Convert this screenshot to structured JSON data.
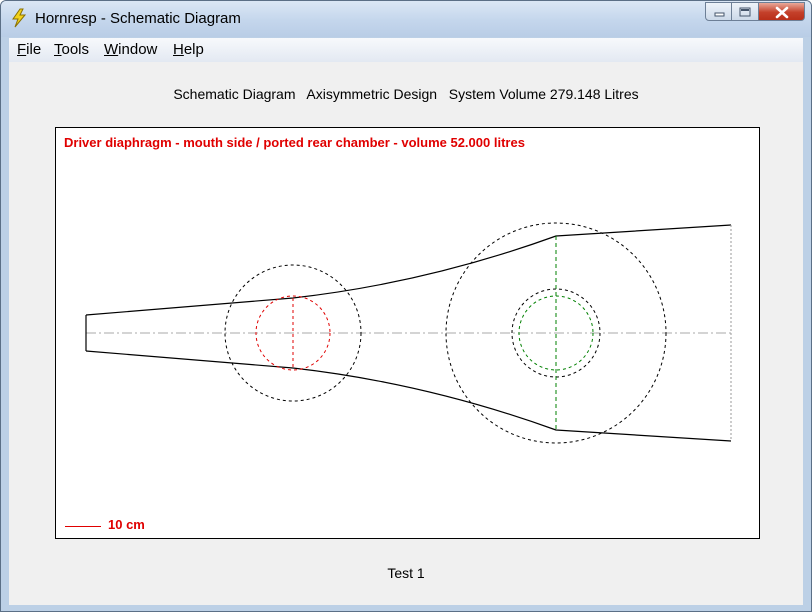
{
  "window": {
    "title": "Hornresp - Schematic Diagram",
    "app_icon": "lightning-bolt-icon",
    "controls": [
      "minimize-icon",
      "maximize-icon",
      "close-icon"
    ]
  },
  "menu": {
    "items": [
      {
        "label": "File",
        "mnemonic": "F",
        "rest": "ile"
      },
      {
        "label": "Tools",
        "mnemonic": "T",
        "rest": "ools"
      },
      {
        "label": "Window",
        "mnemonic": "W",
        "rest": "indow"
      },
      {
        "label": "Help",
        "mnemonic": "H",
        "rest": "elp"
      }
    ]
  },
  "header": {
    "text": "Schematic Diagram   Axisymmetric Design   System Volume 279.148 Litres"
  },
  "diagram": {
    "driver_note": "Driver diaphragm - mouth side / ported rear chamber - volume 52.000 litres",
    "scale_label": "10 cm",
    "colors": {
      "outline": "#000000",
      "driver": "#e00000",
      "rear_chamber": "#008000",
      "axis": "#999999"
    }
  },
  "footer": {
    "record_title": "Test 1"
  }
}
